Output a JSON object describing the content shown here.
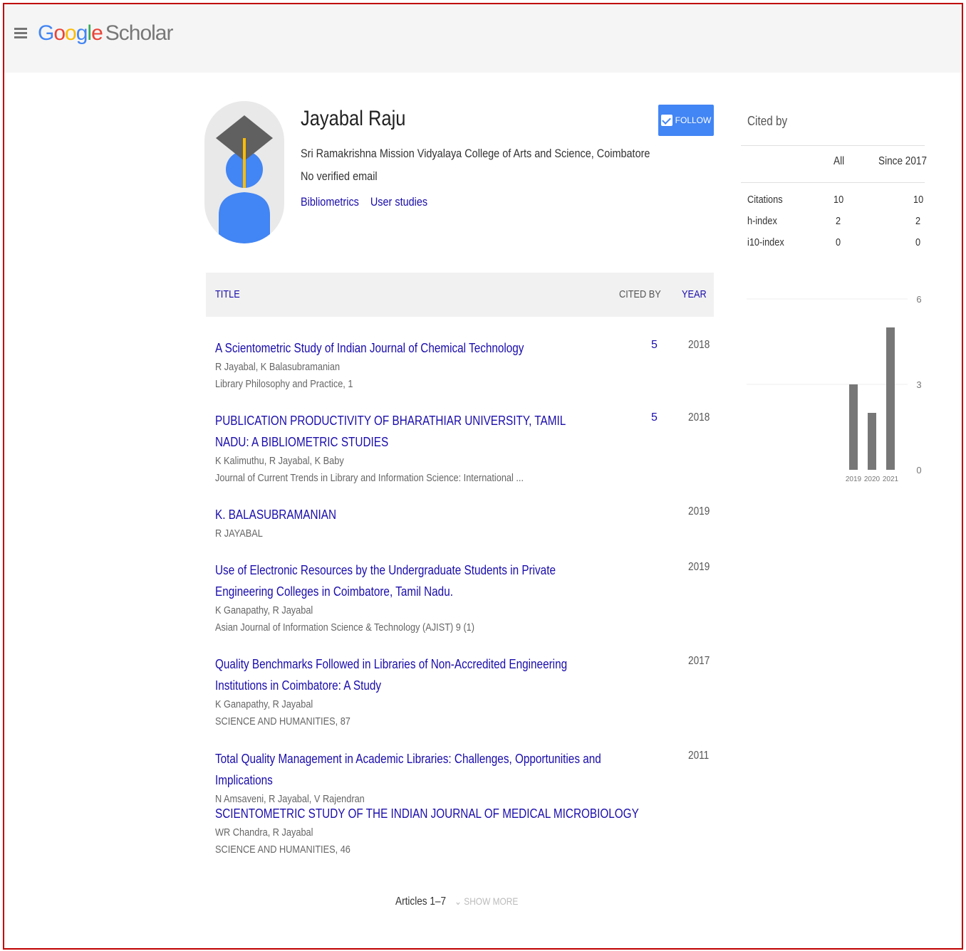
{
  "header": {
    "logo_text": "Google Scholar",
    "logo_google": "Google",
    "logo_scholar": "Scholar"
  },
  "profile": {
    "name": "Jayabal Raju",
    "affiliation": "Sri Ramakrishna Mission Vidyalaya College of Arts and Science, Coimbatore",
    "email": "No verified email",
    "interests": [
      "Bibliometrics",
      "User studies"
    ],
    "follow_label": "FOLLOW"
  },
  "table": {
    "headers": {
      "title": "TITLE",
      "cited_by": "CITED BY",
      "year": "YEAR"
    },
    "articles": [
      {
        "title": "A Scientometric Study of Indian Journal of Chemical Technology",
        "authors": "R Jayabal, K Balasubramanian",
        "source": "Library Philosophy and Practice, 1",
        "cited_by": "5",
        "year": "2018"
      },
      {
        "title": "PUBLICATION PRODUCTIVITY OF BHARATHIAR UNIVERSITY, TAMIL NADU: A BIBLIOMETRIC STUDIES",
        "authors": "K Kalimuthu, R Jayabal, K Baby",
        "source": "Journal of Current Trends in Library and Information Science: International ...",
        "cited_by": "5",
        "year": "2018"
      },
      {
        "title": "K. BALASUBRAMANIAN",
        "authors": "R JAYABAL",
        "source": "",
        "cited_by": "",
        "year": "2019"
      },
      {
        "title": "Use of Electronic Resources by the Undergraduate Students in Private Engineering Colleges in Coimbatore, Tamil Nadu.",
        "authors": "K Ganapathy, R Jayabal",
        "source": "Asian Journal of Information Science & Technology (AJIST) 9 (1)",
        "cited_by": "",
        "year": "2019"
      },
      {
        "title": "Quality Benchmarks Followed in Libraries of Non-Accredited Engineering Institutions in Coimbatore: A Study",
        "authors": "K Ganapathy, R Jayabal",
        "source": "SCIENCE AND HUMANITIES, 87",
        "cited_by": "",
        "year": "2017"
      },
      {
        "title": "Total Quality Management in Academic Libraries: Challenges, Opportunities and Implications",
        "authors": "N Amsaveni, R Jayabal, V Rajendran",
        "source": "",
        "cited_by": "",
        "year": "2011"
      },
      {
        "title": "SCIENTOMETRIC STUDY OF THE INDIAN JOURNAL OF MEDICAL MICROBIOLOGY",
        "authors": "WR Chandra, R Jayabal",
        "source": "SCIENCE AND HUMANITIES, 46",
        "cited_by": "",
        "year": ""
      }
    ]
  },
  "pager": {
    "articles_label": "Articles 1–7",
    "show_more": "SHOW MORE"
  },
  "cited_by": {
    "title": "Cited by",
    "col_all": "All",
    "col_since": "Since 2017",
    "rows": [
      {
        "label": "Citations",
        "all": "10",
        "since": "10"
      },
      {
        "label": "h-index",
        "all": "2",
        "since": "2"
      },
      {
        "label": "i10-index",
        "all": "0",
        "since": "0"
      }
    ]
  },
  "chart_data": {
    "type": "bar",
    "categories": [
      "2019",
      "2020",
      "2021"
    ],
    "values": [
      3,
      2,
      5
    ],
    "ylim": [
      0,
      6
    ],
    "yticks": [
      "0",
      "3",
      "6"
    ],
    "bar_color": "#777777",
    "grid": true
  }
}
